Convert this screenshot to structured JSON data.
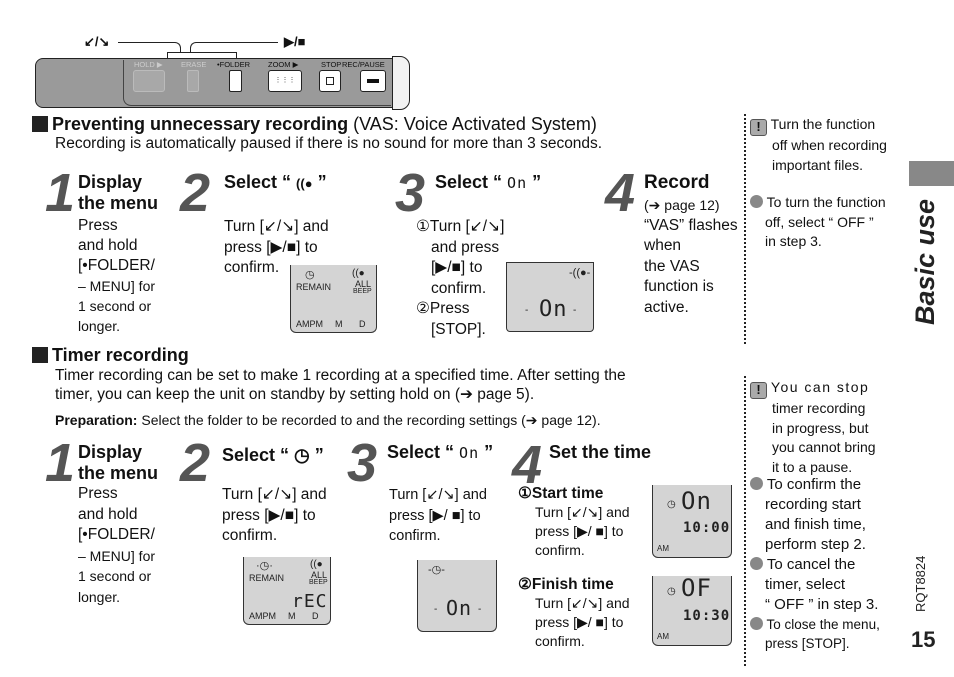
{
  "device": {
    "callout_left": "↙/↘",
    "callout_right": "▶/■",
    "labels": [
      "HOLD ▶",
      "ERASE",
      "•FOLDER",
      "ZOOM ▶",
      "STOP",
      "REC/PAUSE"
    ]
  },
  "vas_section": {
    "title_bold": "Preventing unnecessary recording",
    "title_normal": "(VAS: Voice Activated System)",
    "description": "Recording is automatically paused if there is no sound for more than 3 seconds.",
    "steps": [
      {
        "number": "1",
        "heading_line1": "Display",
        "heading_line2": "the menu",
        "lines": [
          "Press",
          "and hold",
          "[•FOLDER/",
          "– MENU] for",
          "1 second or",
          "longer."
        ]
      },
      {
        "number": "2",
        "heading": "Select “ ",
        "heading_icon": "VAS",
        "heading_end": " ”",
        "lines": [
          "Turn [↙/↘] and",
          "press [▶/■] to",
          "confirm."
        ],
        "lcd": {
          "labels": [
            "REMAIN",
            "ALL",
            "BEEP",
            "AMPM",
            "M",
            "D"
          ]
        }
      },
      {
        "number": "3",
        "heading": "Select “ ",
        "heading_seg": "On",
        "heading_end": " ”",
        "lines": [
          "①Turn [↙/↘]",
          "and press",
          "[▶/■] to",
          "confirm.",
          "②Press",
          "[STOP]."
        ],
        "lcd": {
          "segment": "On"
        }
      },
      {
        "number": "4",
        "heading": "Record",
        "lines": [
          "(➔ page 12)",
          "“VAS” flashes",
          "when",
          "the VAS",
          "function is",
          "active."
        ]
      }
    ],
    "notes": [
      {
        "type": "warning",
        "lines": [
          "Turn the function",
          "off when recording",
          "important files."
        ]
      },
      {
        "type": "bullet",
        "lines": [
          "To turn the function",
          "off, select “ OFF ”",
          "in step 3."
        ]
      }
    ]
  },
  "sidebar": {
    "tab_label": "Basic use",
    "doc_code": "RQT8824",
    "page_number": "15"
  },
  "timer_section": {
    "title": "Timer recording",
    "description_line1": "Timer recording can be set to make 1 recording at a specified time. After setting the",
    "description_line2": "timer, you can keep the unit on standby by setting hold on (➔ page 5).",
    "preparation_label": "Preparation:",
    "preparation_text": " Select the folder to be recorded to and the recording settings (➔ page 12).",
    "steps": [
      {
        "number": "1",
        "heading_line1": "Display",
        "heading_line2": "the menu",
        "lines": [
          "Press",
          "and hold",
          "[•FOLDER/",
          "– MENU] for",
          "1 second or",
          "longer."
        ]
      },
      {
        "number": "2",
        "heading": "Select “ ◷ ”",
        "lines": [
          "Turn [↙/↘] and",
          "press [▶/■] to",
          "confirm."
        ],
        "lcd": {
          "labels": [
            "REMAIN",
            "ALL",
            "BEEP",
            "AMPM",
            "M",
            "D"
          ],
          "segment": "rEC"
        }
      },
      {
        "number": "3",
        "heading": "Select “ ",
        "heading_seg": "On",
        "heading_end": " ”",
        "lines": [
          "Turn [↙/↘] and",
          "press [▶/ ■] to",
          "confirm."
        ],
        "lcd": {
          "segment": "On"
        }
      },
      {
        "number": "4",
        "heading": "Set the time",
        "substeps": [
          {
            "label": "①Start time",
            "lines": [
              "Turn [↙/↘] and",
              "press [▶/ ■] to",
              "confirm."
            ],
            "lcd": {
              "top": "On",
              "time": "10:00",
              "ampm": "AM"
            }
          },
          {
            "label": "②Finish time",
            "lines": [
              "Turn [↙/↘] and",
              "press [▶/ ■] to",
              "confirm."
            ],
            "lcd": {
              "top": "OF",
              "time": "10:30",
              "ampm": "AM"
            }
          }
        ]
      }
    ],
    "notes": [
      {
        "type": "warning",
        "lines": [
          "You can stop",
          "timer recording",
          "in progress, but",
          "you cannot bring",
          "it to a pause."
        ]
      },
      {
        "type": "bullet",
        "lines": [
          "To confirm the",
          "recording start",
          "and finish time,",
          "perform step 2."
        ]
      },
      {
        "type": "bullet",
        "lines": [
          "To cancel the",
          "timer, select",
          "“ OFF ” in step 3."
        ]
      },
      {
        "type": "bullet",
        "lines": [
          "To close the menu,",
          "press [STOP]."
        ]
      }
    ]
  }
}
